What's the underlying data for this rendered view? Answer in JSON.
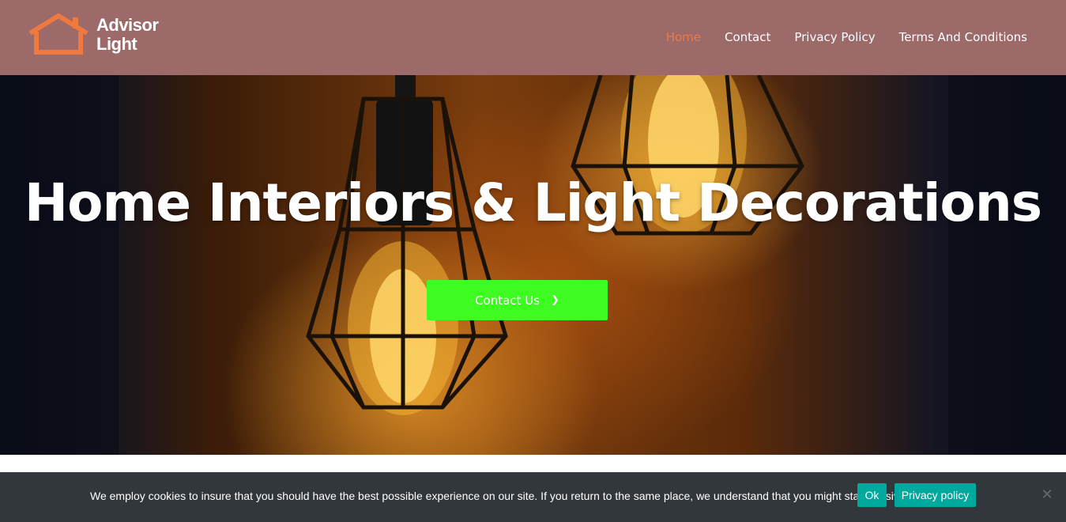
{
  "brand": {
    "name_line1": "Advisor",
    "name_line2": "Light",
    "logo_color": "#f0793f"
  },
  "nav": {
    "items": [
      {
        "label": "Home",
        "active": true
      },
      {
        "label": "Contact",
        "active": false
      },
      {
        "label": "Privacy Policy",
        "active": false
      },
      {
        "label": "Terms And Conditions",
        "active": false
      }
    ]
  },
  "hero": {
    "title": "Home Interiors & Light Decorations",
    "button_label": "Contact Us",
    "button_icon": "chevron-right-icon",
    "button_color": "#3efc22"
  },
  "cookie_notice": {
    "text": "We employ cookies to insure that you should have the best possible experience on our site. If you return to the same place, we understand that you might stay passive.",
    "ok_label": "Ok",
    "policy_label": "Privacy policy",
    "close_icon": "close-icon",
    "button_color": "#00a99d"
  },
  "colors": {
    "header_bg": "#9b6a69",
    "accent": "#f0793f",
    "cookie_bg": "#32373c"
  }
}
